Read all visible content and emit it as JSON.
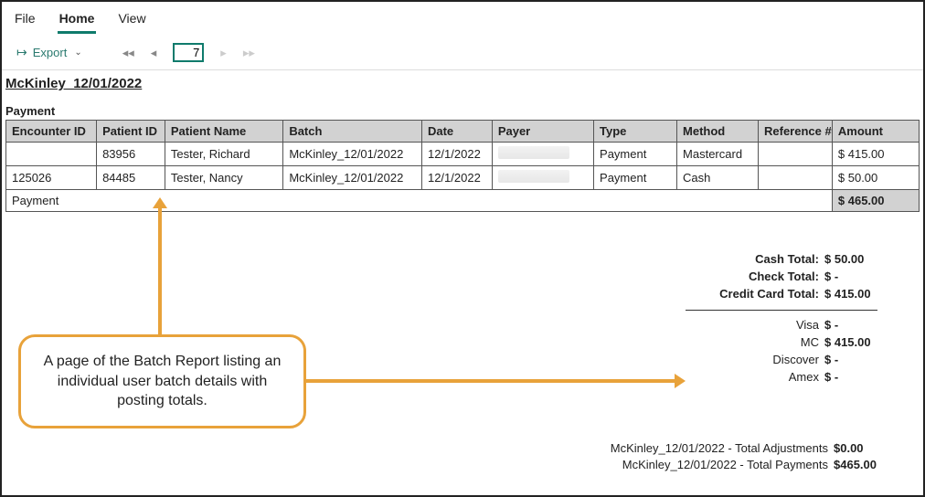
{
  "menu": {
    "file": "File",
    "home": "Home",
    "view": "View"
  },
  "toolbar": {
    "export": "Export",
    "page_value": "7"
  },
  "report": {
    "batch_title": "McKinley_12/01/2022",
    "section_label": "Payment",
    "columns": [
      "Encounter ID",
      "Patient ID",
      "Patient Name",
      "Batch",
      "Date",
      "Payer",
      "Type",
      "Method",
      "Reference #",
      "Amount"
    ],
    "rows": [
      {
        "encounter": "",
        "patient_id": "83956",
        "patient_name": "Tester, Richard",
        "batch": "McKinley_12/01/2022",
        "date": "12/1/2022",
        "payer": "",
        "type": "Payment",
        "method": "Mastercard",
        "ref": "",
        "amount": "$ 415.00"
      },
      {
        "encounter": "125026",
        "patient_id": "84485",
        "patient_name": "Tester, Nancy",
        "batch": "McKinley_12/01/2022",
        "date": "12/1/2022",
        "payer": "",
        "type": "Payment",
        "method": "Cash",
        "ref": "",
        "amount": "$ 50.00"
      }
    ],
    "footer": {
      "label": "Payment",
      "amount": "$ 465.00"
    }
  },
  "summary": {
    "cash": {
      "label": "Cash Total:",
      "value": "$ 50.00"
    },
    "check": {
      "label": "Check Total:",
      "value": "$  -"
    },
    "cc": {
      "label": "Credit Card Total:",
      "value": "$ 415.00"
    },
    "visa": {
      "label": "Visa",
      "value": "$  -"
    },
    "mc": {
      "label": "MC",
      "value": "$ 415.00"
    },
    "discover": {
      "label": "Discover",
      "value": "$  -"
    },
    "amex": {
      "label": "Amex",
      "value": "$  -"
    }
  },
  "finals": {
    "adj": {
      "label": "McKinley_12/01/2022 - Total Adjustments",
      "value": "$0.00"
    },
    "pay": {
      "label": "McKinley_12/01/2022 - Total Payments",
      "value": "$465.00"
    }
  },
  "callout": {
    "text": "A page of the Batch Report listing an individual user batch details with posting totals."
  }
}
